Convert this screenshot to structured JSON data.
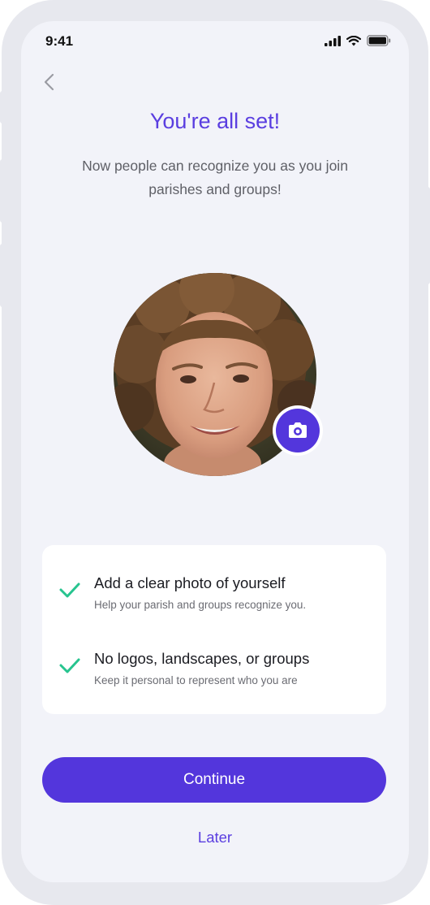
{
  "status_bar": {
    "time": "9:41"
  },
  "header": {
    "title": "You're all set!",
    "subtitle": "Now people can recognize you as you join parishes and groups!"
  },
  "profile": {
    "avatar_icon": "profile-photo",
    "camera_icon": "camera-icon"
  },
  "tips": [
    {
      "icon": "check-icon",
      "title": "Add a clear photo of yourself",
      "description": "Help your parish and groups recognize you."
    },
    {
      "icon": "check-icon",
      "title": "No logos, landscapes, or groups",
      "description": "Keep it personal to represent who you are"
    }
  ],
  "actions": {
    "continue_label": "Continue",
    "later_label": "Later"
  },
  "colors": {
    "accent": "#5336dc",
    "title": "#5a3ee0",
    "check": "#27c48f",
    "screen_bg": "#f2f3f9",
    "frame": "#e7e8ee"
  }
}
